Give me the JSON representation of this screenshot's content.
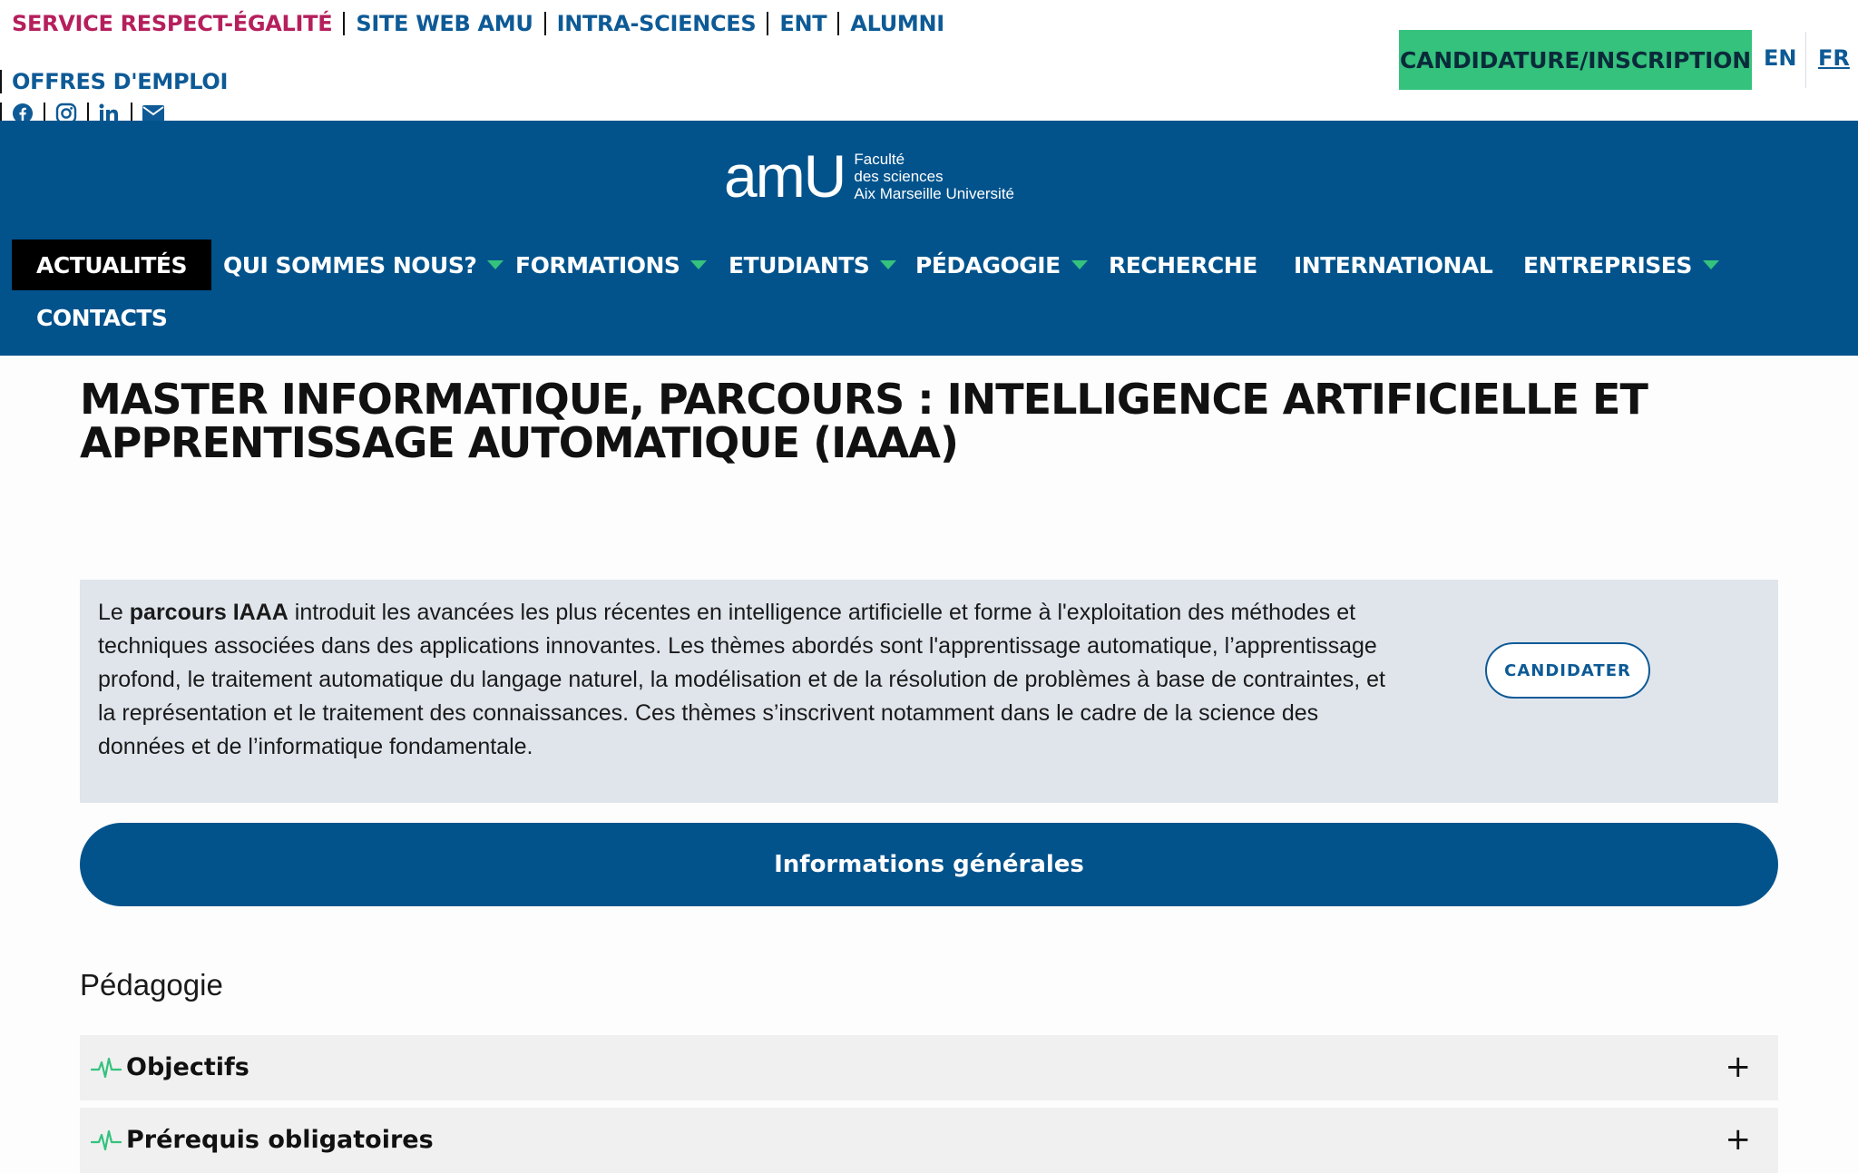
{
  "top_links": {
    "respect": "SERVICE RESPECT-ÉGALITÉ",
    "amu": "SITE WEB AMU",
    "intra": "INTRA-SCIENCES",
    "ent": "ENT",
    "alumni": "ALUMNI",
    "offres": "OFFRES D'EMPLOI"
  },
  "social_icons": [
    "facebook-icon",
    "instagram-icon",
    "linkedin-icon",
    "mail-icon"
  ],
  "apply_button": "CANDIDATURE/INSCRIPTION",
  "languages": {
    "en": "EN",
    "fr": "FR"
  },
  "logo": {
    "mark": "amU",
    "line1": "Faculté",
    "line2": "des sciences",
    "line3": "Aix Marseille Université"
  },
  "nav": {
    "actualites": "ACTUALITÉS",
    "qui": "QUI SOMMES NOUS?",
    "formations": "FORMATIONS",
    "etudiants": "ETUDIANTS",
    "pedagogie": "PÉDAGOGIE",
    "recherche": "RECHERCHE",
    "international": "INTERNATIONAL",
    "entreprises": "ENTREPRISES",
    "contacts": "CONTACTS"
  },
  "page_title": "MASTER INFORMATIQUE, PARCOURS : INTELLIGENCE ARTIFICIELLE ET APPRENTISSAGE AUTOMATIQUE (IAAA)",
  "intro": {
    "prefix": "Le ",
    "bold": "parcours IAAA",
    "rest": " introduit les avancées les plus récentes en intelligence artificielle et forme à l'exploitation des méthodes et techniques associées dans des applications innovantes. Les thèmes abordés sont l'apprentissage automatique, l’apprentissage profond, le traitement automatique du langage naturel, la modélisation et de la résolution de problèmes à base de contraintes, et la représentation et le traitement des connaissances. Ces thèmes s’inscrivent notamment dans le cadre de la science des données et de l’informatique fondamentale.",
    "button": "CANDIDATER"
  },
  "info_button": "Informations générales",
  "section_title": "Pédagogie",
  "accordion": [
    {
      "label": "Objectifs",
      "toggle": "+"
    },
    {
      "label": "Prérequis obligatoires",
      "toggle": "+"
    }
  ],
  "colors": {
    "brand_blue": "#02538c",
    "accent_green": "#34c27d",
    "accent_magenta": "#b51f5c"
  }
}
